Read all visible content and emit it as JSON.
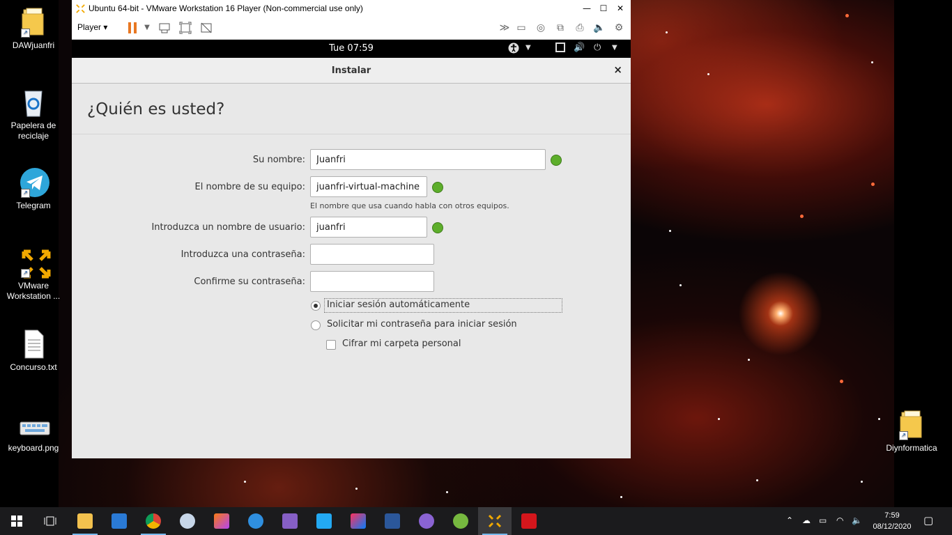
{
  "desktop": {
    "icons": [
      {
        "label": "DAWjuanfri",
        "icon": "folder-icon"
      },
      {
        "label": "Papelera de reciclaje",
        "icon": "recycle-bin-icon"
      },
      {
        "label": "Telegram",
        "icon": "telegram-icon"
      },
      {
        "label": "VMware Workstation ...",
        "icon": "vmware-icon"
      },
      {
        "label": "Concurso.txt",
        "icon": "text-file-icon"
      },
      {
        "label": "keyboard.png",
        "icon": "image-file-icon"
      },
      {
        "label": "Diynformatica",
        "icon": "folder-icon"
      }
    ]
  },
  "vmware": {
    "title": "Ubuntu 64-bit - VMware Workstation 16 Player (Non-commercial use only)",
    "player_menu": "Player",
    "window_buttons": {
      "minimize": "—",
      "maximize": "☐",
      "close": "✕"
    },
    "toolbar_icons": [
      "pause-icon",
      "dropdown-icon",
      "send-ctrl-alt-del-icon",
      "fullscreen-icon",
      "unity-icon",
      "more-icon",
      "hdd-icon",
      "cd-icon",
      "network-icon",
      "printer-icon",
      "sound-icon",
      "usb-icon"
    ]
  },
  "gnome": {
    "clock": "Tue 07:59"
  },
  "installer": {
    "window_title": "Instalar",
    "close_symbol": "×",
    "heading": "¿Quién es usted?",
    "fields": {
      "name": {
        "label": "Su nombre:",
        "value": "Juanfri"
      },
      "computer": {
        "label": "El nombre de su equipo:",
        "value": "juanfri-virtual-machine",
        "hint": "El nombre que usa cuando habla con otros equipos."
      },
      "username": {
        "label": "Introduzca un nombre de usuario:",
        "value": "juanfri"
      },
      "password": {
        "label": "Introduzca una contraseña:",
        "value": ""
      },
      "confirm": {
        "label": "Confirme su contraseña:",
        "value": ""
      }
    },
    "options": {
      "auto_login": {
        "label": "Iniciar sesión automáticamente",
        "selected": true
      },
      "require_password": {
        "label": "Solicitar mi contraseña para iniciar sesión",
        "selected": false
      },
      "encrypt_home": {
        "label": "Cifrar mi carpeta personal",
        "checked": false
      }
    }
  },
  "taskbar": {
    "apps": [
      "file-explorer-icon",
      "mail-icon",
      "chrome-icon",
      "paint-icon",
      "jetbrains-icon",
      "thunderbird-icon",
      "visual-studio-icon",
      "vscode-icon",
      "intellij-icon",
      "word-icon",
      "github-desktop-icon",
      "utorrent-icon",
      "vmware-icon",
      "acrobat-icon"
    ],
    "time": "7:59",
    "date": "08/12/2020"
  }
}
